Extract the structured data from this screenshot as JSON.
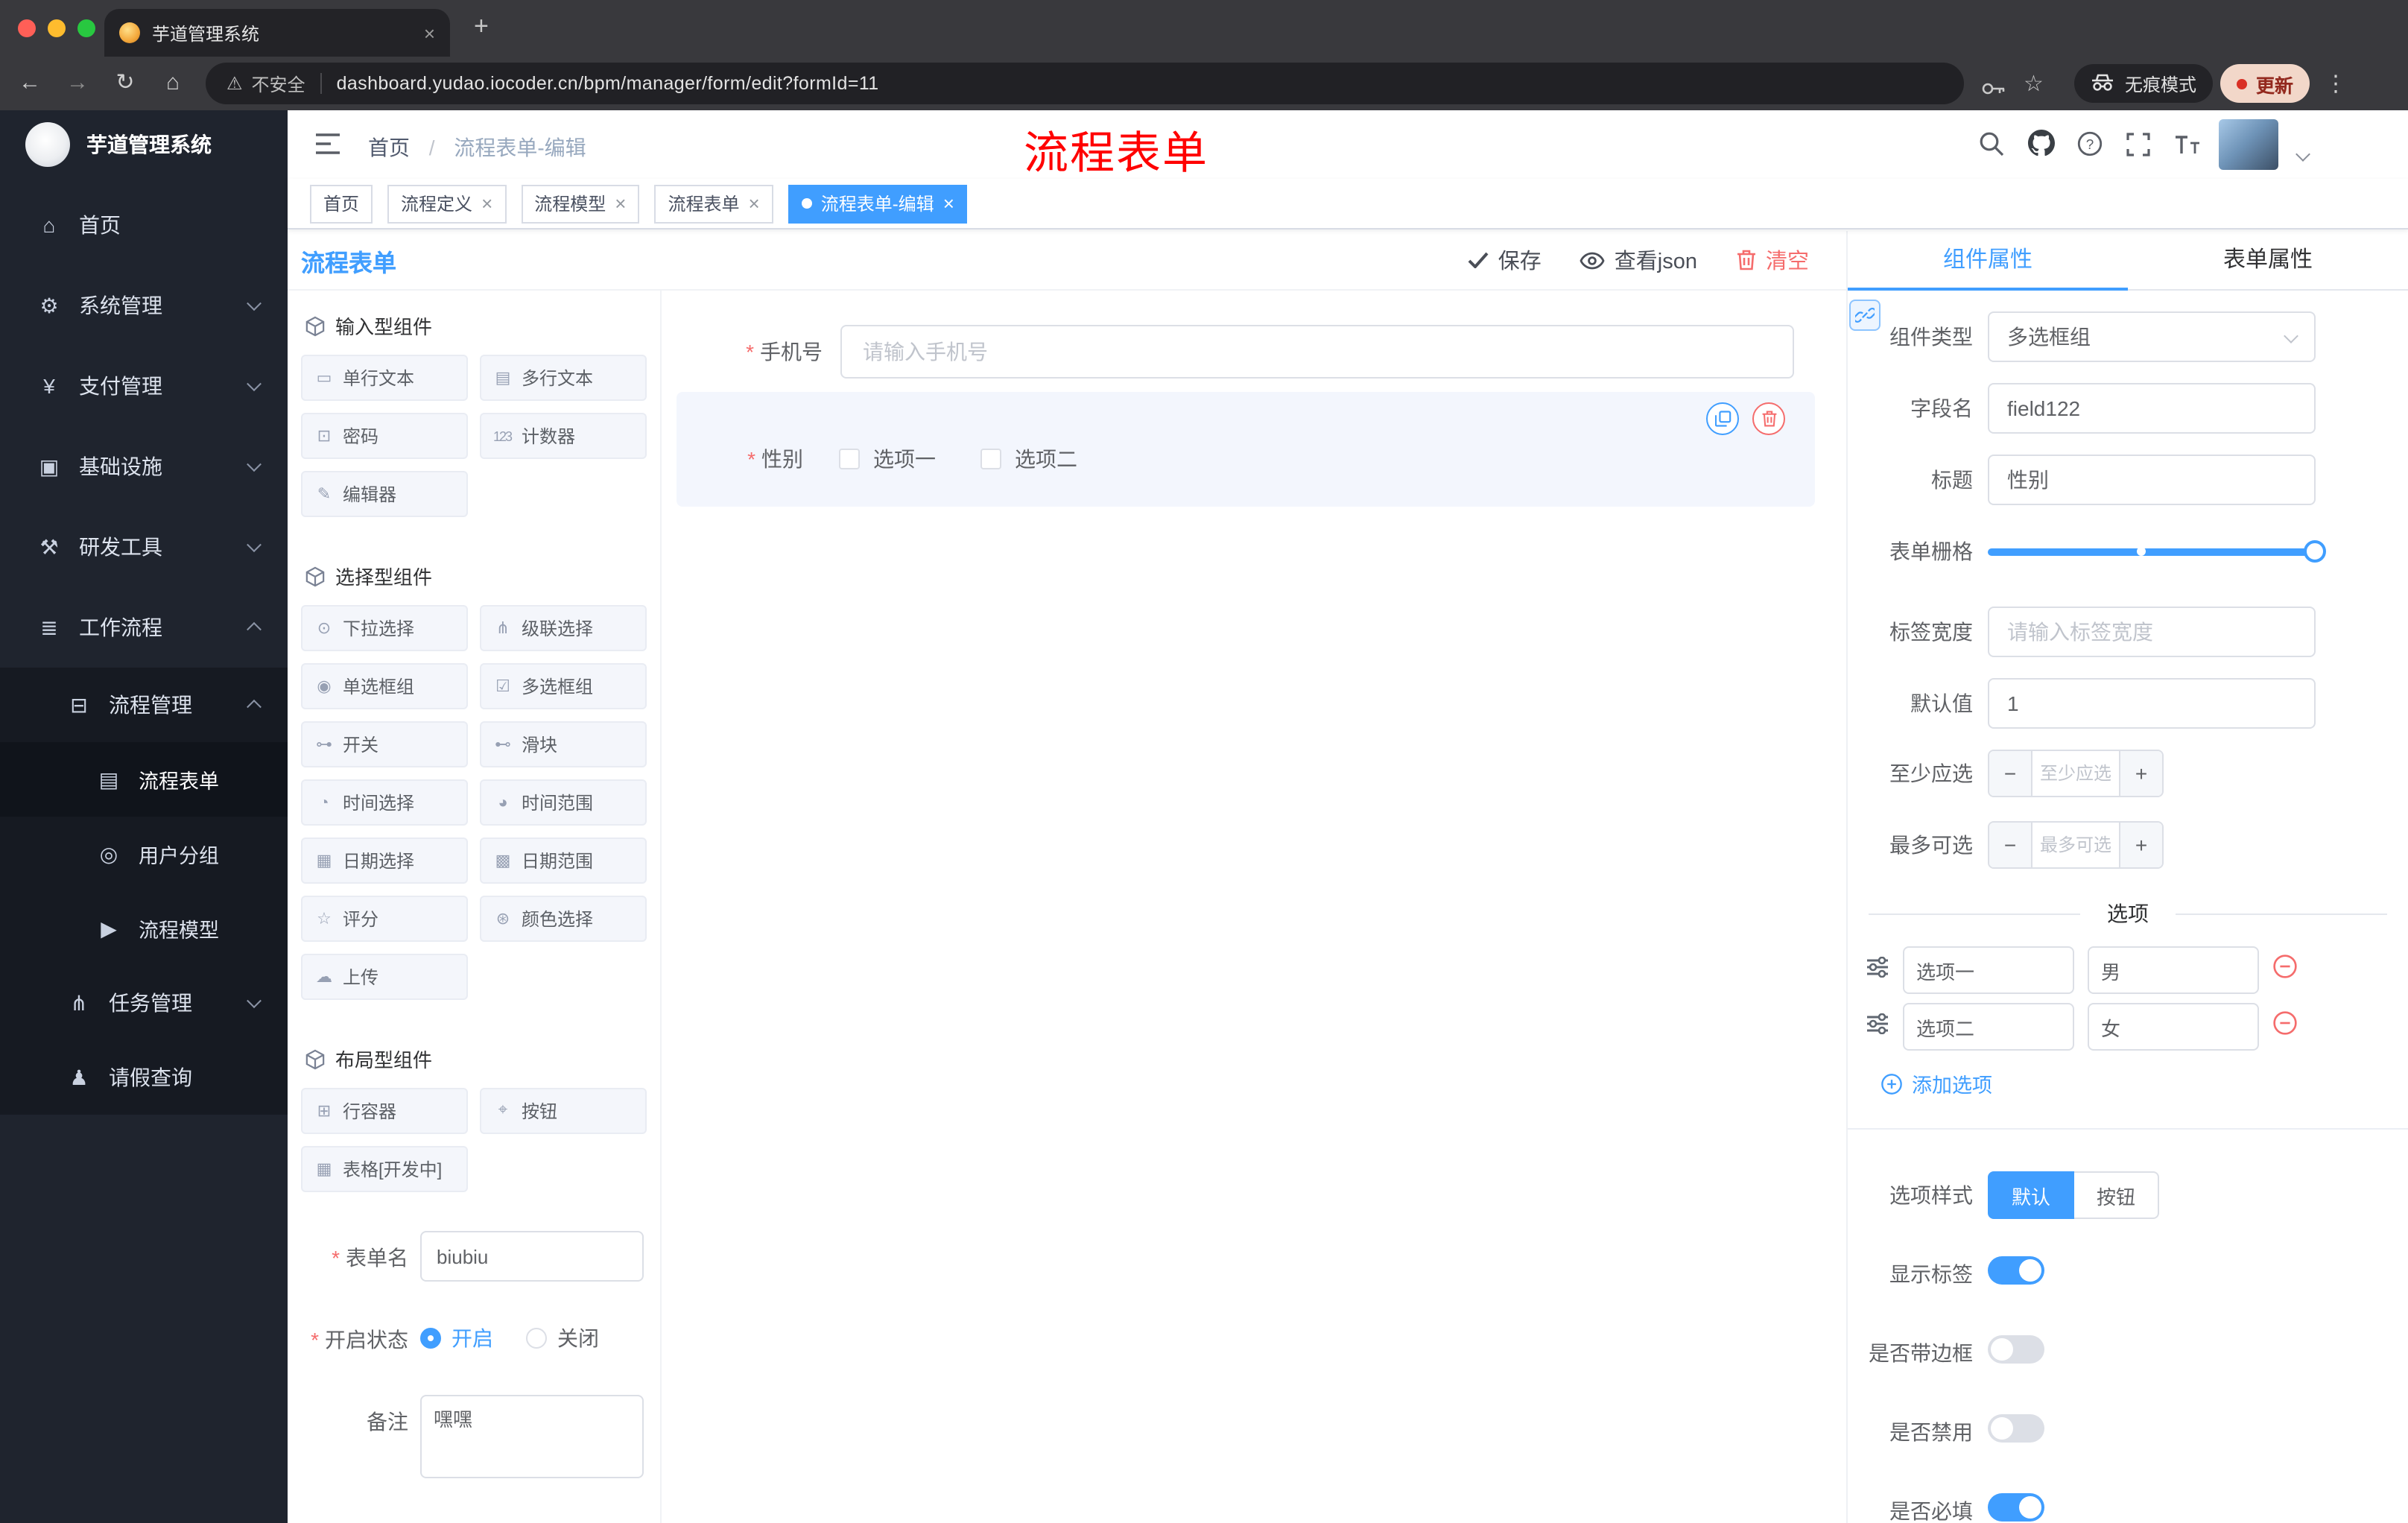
{
  "accent": "#409eff",
  "danger": "#f56c6c",
  "glyphs": {
    "close": "×",
    "plus": "+",
    "minus": "−",
    "back": "←",
    "forward": "→",
    "reload": "↻",
    "home": "⌂",
    "warning": "⚠",
    "star": "☆",
    "dots": "⋮"
  },
  "browser": {
    "tab_title": "芋道管理系统",
    "security_label": "不安全",
    "url": "dashboard.yudao.iocoder.cn/bpm/manager/form/edit?formId=11",
    "incognito_label": "无痕模式",
    "update_label": "更新"
  },
  "sidebar": {
    "app_title": "芋道管理系统",
    "items": [
      {
        "icon": "⌂",
        "label": "首页"
      },
      {
        "icon": "⚙",
        "label": "系统管理"
      },
      {
        "icon": "¥",
        "label": "支付管理"
      },
      {
        "icon": "▣",
        "label": "基础设施"
      },
      {
        "icon": "⚒",
        "label": "研发工具"
      },
      {
        "icon": "≣",
        "label": "工作流程"
      }
    ],
    "workflow_submenu": {
      "process_mgmt": {
        "icon": "⊟",
        "label": "流程管理"
      },
      "process_mgmt_children": [
        {
          "icon": "▤",
          "label": "流程表单"
        },
        {
          "icon": "◎",
          "label": "用户分组"
        },
        {
          "icon": "▶",
          "label": "流程模型"
        }
      ],
      "task_mgmt": {
        "icon": "⋔",
        "label": "任务管理"
      },
      "leave_query": {
        "icon": "♟",
        "label": "请假查询"
      }
    }
  },
  "header": {
    "breadcrumb": {
      "home": "首页",
      "separator": "/",
      "current": "流程表单-编辑"
    },
    "annotation": "流程表单"
  },
  "tags": [
    {
      "label": "首页"
    },
    {
      "label": "流程定义"
    },
    {
      "label": "流程模型"
    },
    {
      "label": "流程表单"
    },
    {
      "label": "流程表单-编辑"
    }
  ],
  "designer": {
    "title": "流程表单",
    "toolbar": {
      "save": "保存",
      "view_json": "查看json",
      "clear": "清空"
    },
    "palette": {
      "sections": [
        {
          "title": "输入型组件",
          "items": [
            {
              "icon": "▭",
              "label": "单行文本"
            },
            {
              "icon": "▤",
              "label": "多行文本"
            },
            {
              "icon": "⊡",
              "label": "密码"
            },
            {
              "icon": "123",
              "label": "计数器"
            },
            {
              "icon": "✎",
              "label": "编辑器"
            }
          ]
        },
        {
          "title": "选择型组件",
          "items": [
            {
              "icon": "⊙",
              "label": "下拉选择"
            },
            {
              "icon": "⋔",
              "label": "级联选择"
            },
            {
              "icon": "◉",
              "label": "单选框组"
            },
            {
              "icon": "☑",
              "label": "多选框组"
            },
            {
              "icon": "⊶",
              "label": "开关"
            },
            {
              "icon": "⊷",
              "label": "滑块"
            },
            {
              "icon": "◔",
              "label": "时间选择"
            },
            {
              "icon": "◕",
              "label": "时间范围"
            },
            {
              "icon": "▦",
              "label": "日期选择"
            },
            {
              "icon": "▩",
              "label": "日期范围"
            },
            {
              "icon": "☆",
              "label": "评分"
            },
            {
              "icon": "⊛",
              "label": "颜色选择"
            },
            {
              "icon": "☁",
              "label": "上传"
            }
          ]
        },
        {
          "title": "布局型组件",
          "items": [
            {
              "icon": "⊞",
              "label": "行容器"
            },
            {
              "icon": "⌖",
              "label": "按钮"
            },
            {
              "icon": "▦",
              "label": "表格[开发中]"
            }
          ]
        }
      ]
    },
    "form_meta": {
      "name_label": "表单名",
      "name_value": "biubiu",
      "status_label": "开启状态",
      "status_on": "开启",
      "status_off": "关闭",
      "remark_label": "备注",
      "remark_value": "嘿嘿"
    },
    "canvas": {
      "phone": {
        "label": "手机号",
        "placeholder": "请输入手机号"
      },
      "gender": {
        "label": "性别",
        "option1": "选项一",
        "option2": "选项二"
      }
    }
  },
  "properties": {
    "tab_component": "组件属性",
    "tab_form": "表单属性",
    "component_type": {
      "label": "组件类型",
      "value": "多选框组"
    },
    "field_name": {
      "label": "字段名",
      "value": "field122"
    },
    "title": {
      "label": "标题",
      "value": "性别"
    },
    "grid": {
      "label": "表单栅格"
    },
    "label_width": {
      "label": "标签宽度",
      "placeholder": "请输入标签宽度"
    },
    "default_value": {
      "label": "默认值",
      "value": "1"
    },
    "min_select": {
      "label": "至少应选",
      "placeholder": "至少应选"
    },
    "max_select": {
      "label": "最多可选",
      "placeholder": "最多可选"
    },
    "options_title": "选项",
    "options": [
      {
        "name": "选项一",
        "value": "男"
      },
      {
        "name": "选项二",
        "value": "女"
      }
    ],
    "add_option": "添加选项",
    "option_style": {
      "label": "选项样式",
      "default": "默认",
      "button": "按钮"
    },
    "show_label": "显示标签",
    "bordered": "是否带边框",
    "disabled": "是否禁用",
    "required": "是否必填"
  }
}
